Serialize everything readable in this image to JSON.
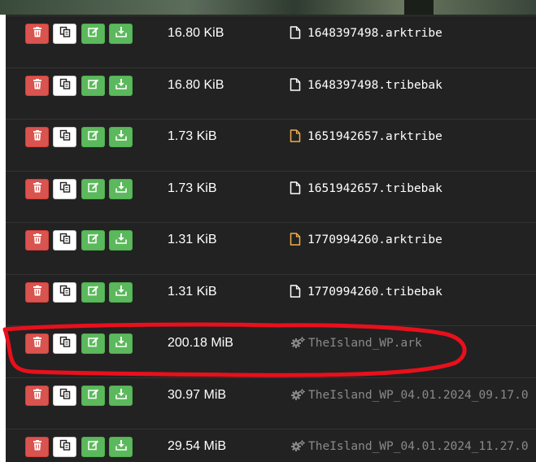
{
  "files": [
    {
      "size": "16.80 KiB",
      "name": "1648397498.arktribe",
      "icon": "file-icon",
      "icon_color": "#ffffff",
      "dim": false
    },
    {
      "size": "16.80 KiB",
      "name": "1648397498.tribebak",
      "icon": "file-icon",
      "icon_color": "#ffffff",
      "dim": false
    },
    {
      "size": "1.73 KiB",
      "name": "1651942657.arktribe",
      "icon": "file-icon",
      "icon_color": "#f0ad4e",
      "dim": false
    },
    {
      "size": "1.73 KiB",
      "name": "1651942657.tribebak",
      "icon": "file-icon",
      "icon_color": "#ffffff",
      "dim": false
    },
    {
      "size": "1.31 KiB",
      "name": "1770994260.arktribe",
      "icon": "file-icon",
      "icon_color": "#f0ad4e",
      "dim": false
    },
    {
      "size": "1.31 KiB",
      "name": "1770994260.tribebak",
      "icon": "file-icon",
      "icon_color": "#ffffff",
      "dim": false
    },
    {
      "size": "200.18 MiB",
      "name": "TheIsland_WP.ark",
      "icon": "gears-icon",
      "icon_color": "#8a8a8a",
      "dim": true
    },
    {
      "size": "30.97 MiB",
      "name": "TheIsland_WP_04.01.2024_09.17.0",
      "icon": "gears-icon",
      "icon_color": "#8a8a8a",
      "dim": true
    },
    {
      "size": "29.54 MiB",
      "name": "TheIsland_WP_04.01.2024_11.27.0",
      "icon": "gears-icon",
      "icon_color": "#8a8a8a",
      "dim": true
    }
  ],
  "colors": {
    "panel": "#222222",
    "delete": "#d9534f",
    "success": "#5cb85c",
    "annotation": "#e8101c"
  },
  "icons": {
    "delete": "trash-icon",
    "copy": "copy-icon",
    "edit": "edit-icon",
    "download": "download-icon"
  }
}
